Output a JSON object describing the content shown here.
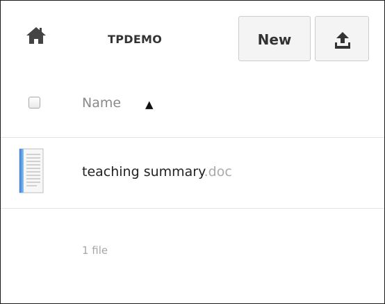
{
  "toolbar": {
    "home_icon": "home-icon",
    "breadcrumb": "TPDEMO",
    "new_button_label": "New",
    "upload_icon": "upload-icon"
  },
  "file_list": {
    "header": {
      "select_all_checked": false,
      "name_column": "Name",
      "sort_indicator": "▲",
      "sort_direction": "ascending"
    },
    "rows": [
      {
        "icon": "document-icon",
        "name": "teaching summary",
        "extension": ".doc"
      }
    ],
    "summary": "1 file"
  },
  "colors": {
    "button_background": "#f4f4f4",
    "button_border": "#cccccc",
    "icon_dark": "#444444",
    "doc_icon_accent": "#4a90d9",
    "muted_text": "#aaaaaa"
  }
}
